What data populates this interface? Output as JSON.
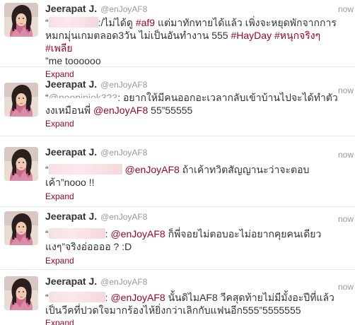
{
  "tweets": [
    {
      "fullname": "Jeerapat J.",
      "username": "@enJoyAF8",
      "time": "now",
      "quote_open": "“",
      "pre_text": ":/ไม่ได้ดู ",
      "hashtag1": "#af9",
      "mid_text": " แต่มาทักทายได้แล้ว เพิ่งจะหยุดพักจากการหมกมุ่นเกมตลอด3วัน ไม่เป็นอันทำงาน 555 ",
      "hashtag2": "#HayDay",
      "hashtag3": "#หนุกจริงๆ",
      "hashtag4": "#เพลีย",
      "end_text": "”me toooooo",
      "expand": "Expand"
    },
    {
      "fullname": "Jeerapat J.",
      "username": "@enJoyAF8",
      "time": "now",
      "quote_open": "“",
      "partial_mention": "@noopiniok323",
      "pre_text": ": อยากให้มีคนออกอะเวลากลับเข้าบ้านไปจะได้ทำตัวงงเหมือนพี่ ",
      "mention": "@enJoyAF8",
      "end_text": " 55”55555",
      "expand": "Expand"
    },
    {
      "fullname": "Jeerapat J.",
      "username": "@enJoyAF8",
      "time": "now",
      "quote_open": "“",
      "mention": "@enJoyAF8",
      "end_text": " ถ้าเค้าทวิตสัญญานะว่าจะตอบเค้า”nooo !!",
      "expand": "Expand"
    },
    {
      "fullname": "Jeerapat J.",
      "username": "@enJoyAF8",
      "time": "now",
      "quote_open": "“",
      "sep": ": ",
      "mention": "@enJoyAF8",
      "end_text": " ก็พี่จอยไม่ตอบอะไม่อยากคุยคนเดียวแงๆ”จริงอ่ออออ ? :D",
      "expand": "Expand"
    },
    {
      "fullname": "Jeerapat J.",
      "username": "@enJoyAF8",
      "time": "now",
      "quote_open": "“",
      "sep": ": ",
      "mention": "@enJoyAF8",
      "end_text": " นั้นดิไมAF8 วีคสุดท้ายไม่มีมั้งอะปีที่แล้วเป็นวีคที่ปวดใจมากร้องไห้ยิ่งกว่าเลิกกับแฟนอีก555”5555555",
      "expand": "Expand"
    }
  ],
  "colors": {
    "name": "#333333",
    "meta": "#999999",
    "hashtag": "#a0042b",
    "link": "#0084b4"
  }
}
